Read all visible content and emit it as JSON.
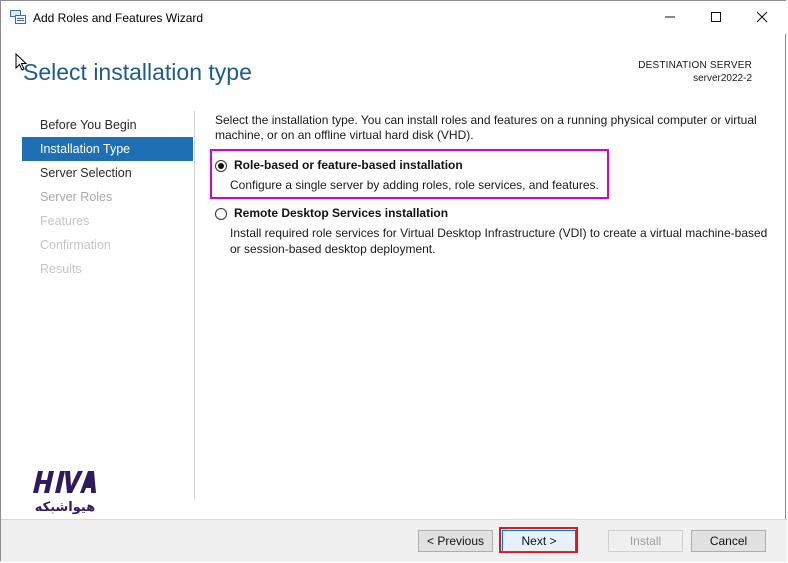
{
  "window": {
    "title": "Add Roles and Features Wizard",
    "controls": {
      "minimize_icon": "minimize-icon",
      "maximize_icon": "maximize-icon",
      "close_icon": "close-icon"
    }
  },
  "header": {
    "page_title": "Select installation type",
    "destination_label": "DESTINATION SERVER",
    "destination_server": "server2022-2"
  },
  "nav": {
    "items": [
      {
        "label": "Before You Begin",
        "state": "normal"
      },
      {
        "label": "Installation Type",
        "state": "active"
      },
      {
        "label": "Server Selection",
        "state": "normal"
      },
      {
        "label": "Server Roles",
        "state": "disabled"
      },
      {
        "label": "Features",
        "state": "disabled"
      },
      {
        "label": "Confirmation",
        "state": "disabled"
      },
      {
        "label": "Results",
        "state": "disabled"
      }
    ]
  },
  "main": {
    "intro": "Select the installation type. You can install roles and features on a running physical computer or virtual machine, or on an offline virtual hard disk (VHD).",
    "options": [
      {
        "title": "Role-based or feature-based installation",
        "description": "Configure a single server by adding roles, role services, and features.",
        "selected": true
      },
      {
        "title": "Remote Desktop Services installation",
        "description": "Install required role services for Virtual Desktop Infrastructure (VDI) to create a virtual machine-based or session-based desktop deployment.",
        "selected": false
      }
    ]
  },
  "footer": {
    "previous_label": "< Previous",
    "next_label": "Next >",
    "install_label": "Install",
    "cancel_label": "Cancel"
  },
  "watermark": {
    "logo_text": "هیواشبکه"
  },
  "colors": {
    "title_blue": "#1e5c86",
    "nav_active": "#1f6fb5",
    "highlight_magenta": "#d400d4",
    "highlight_red": "#e3161b",
    "logo_purple": "#2d1b5e"
  }
}
